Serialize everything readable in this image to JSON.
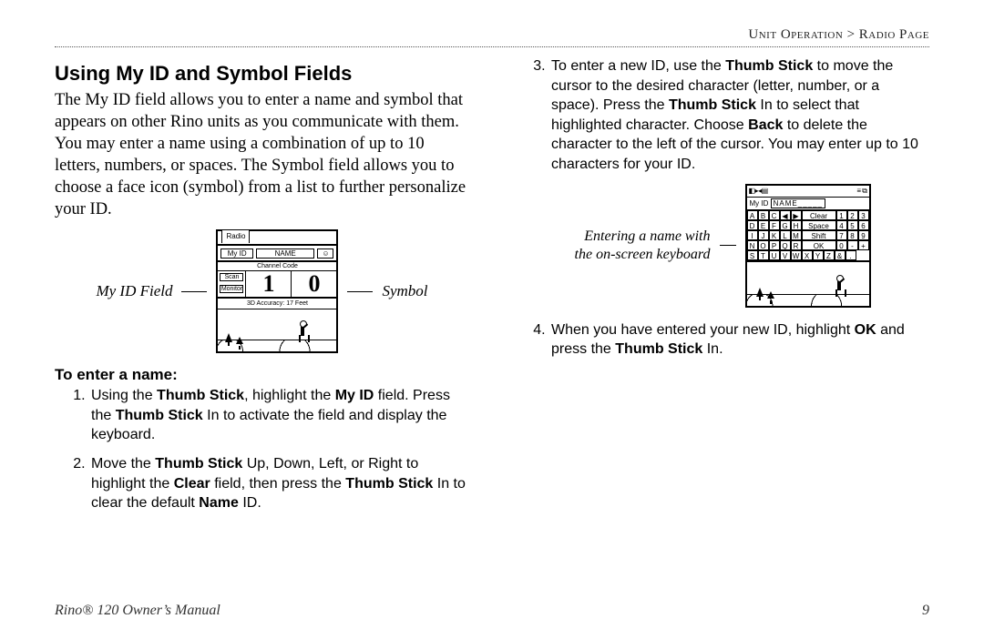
{
  "breadcrumb": {
    "left": "Unit Operation",
    "sep": " > ",
    "right": "Radio Page"
  },
  "heading": "Using My ID and Symbol Fields",
  "intro": "The My ID field allows you to enter a name and symbol that appears on other Rino units as you communicate with them. You may enter a name using a combination of up to 10 letters, numbers, or spaces. The Symbol field allows you to choose a face icon (symbol) from a list to further personalize your ID.",
  "fig1": {
    "label_left": "My ID Field",
    "label_right": "Symbol",
    "screen": {
      "tab": "Radio",
      "id_chip": "My ID",
      "id_value": "NAME",
      "chan_label": "Channel  Code",
      "scan": "Scan",
      "monitor": "Monitor",
      "digit1": "1",
      "digit2": "0",
      "status": "3D Accuracy: 17 Feet"
    }
  },
  "subhead": "To enter a name:",
  "steps_left": [
    "Using the <b>Thumb Stick</b>, highlight the <b>My ID</b> field. Press the <b>Thumb Stick</b> In to activate the field and display the keyboard.",
    "Move the <b>Thumb Stick</b> Up, Down, Left, or Right to highlight the <b>Clear</b> field, then press the <b>Thumb Stick</b> In to clear the default <b>Name</b> ID."
  ],
  "steps_right": [
    "To enter a new ID, use the <b>Thumb Stick</b> to move the cursor to the desired character (letter, number, or a space). Press the <b>Thumb Stick</b> In to select that highlighted character. Choose <b>Back</b> to delete the character to the left of the cursor. You may enter up to 10 characters for your ID.",
    "When you have entered your new ID, highlight <b>OK</b> and press the <b>Thumb Stick</b> In."
  ],
  "fig2": {
    "caption": "Entering a name with the on-screen keyboard",
    "top_left": "◧▸◂▤",
    "top_right": "≡ ⧉",
    "id_label": "My ID",
    "id_value": "NAME_____",
    "rows": [
      [
        "A",
        "B",
        "C",
        "◀",
        "▶",
        "Clear",
        "1",
        "2",
        "3"
      ],
      [
        "D",
        "E",
        "F",
        "G",
        "H",
        "Space",
        "4",
        "5",
        "6"
      ],
      [
        "I",
        "J",
        "K",
        "L",
        "M",
        "Shift",
        "7",
        "8",
        "9"
      ],
      [
        "N",
        "O",
        "P",
        "Q",
        "R",
        "OK",
        "0",
        "-",
        "+"
      ],
      [
        "S",
        "T",
        "U",
        "V",
        "W",
        "X",
        "Y",
        "Z",
        "&",
        "."
      ]
    ]
  },
  "footer": {
    "manual": "Rino® 120 Owner’s Manual",
    "page": "9"
  }
}
